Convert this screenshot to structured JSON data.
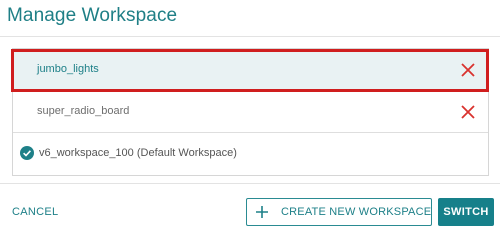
{
  "dialog": {
    "title": "Manage Workspace"
  },
  "workspaces": [
    {
      "name": "jumbo_lights",
      "selected": true,
      "deletable": true
    },
    {
      "name": "super_radio_board",
      "selected": false,
      "deletable": true
    },
    {
      "name": "v6_workspace_100 (Default Workspace)",
      "selected": false,
      "deletable": false,
      "is_default": true
    }
  ],
  "icons": {
    "delete": "close-x-icon",
    "default": "check-circle-icon",
    "create": "plus-icon"
  },
  "footer": {
    "cancel_label": "CANCEL",
    "create_label": "CREATE NEW WORKSPACE",
    "switch_label": "SWITCH"
  },
  "colors": {
    "accent": "#1e8088",
    "delete": "#d9322e",
    "highlight": "#d01e1e",
    "selected_row": "#e9f2f3"
  }
}
